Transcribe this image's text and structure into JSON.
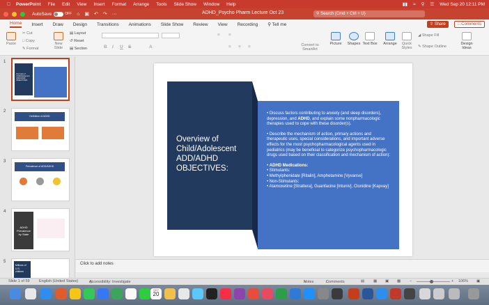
{
  "menubar": {
    "app": "PowerPoint",
    "items": [
      "File",
      "Edit",
      "View",
      "Insert",
      "Format",
      "Arrange",
      "Tools",
      "Slide Show",
      "Window",
      "Help"
    ],
    "datetime": "Wed Sep 20  12:11 PM"
  },
  "titlebar": {
    "autosave_label": "AutoSave",
    "autosave_state": "OFF",
    "doc_title": "ADHD_Psycho Pharm Lecture Oct 23",
    "search_placeholder": "Search (Cmd + Ctrl + U)"
  },
  "ribbon": {
    "tabs": [
      "Home",
      "Insert",
      "Draw",
      "Design",
      "Transitions",
      "Animations",
      "Slide Show",
      "Review",
      "View",
      "Recording",
      "Tell me"
    ],
    "share_label": "Share",
    "comments_label": "Comments",
    "buttons": {
      "paste": "Paste",
      "cut": "Cut",
      "copy": "Copy",
      "format": "Format",
      "new_slide": "New Slide",
      "layout": "Layout",
      "reset": "Reset",
      "section": "Section",
      "convert_smartart": "Convert to SmartArt",
      "picture": "Picture",
      "shapes": "Shapes",
      "text_box": "Text Box",
      "arrange": "Arrange",
      "quick_styles": "Quick Styles",
      "shape_fill": "Shape Fill",
      "shape_outline": "Shape Outline",
      "design_ideas": "Design Ideas"
    }
  },
  "thumbnails": [
    {
      "num": "1",
      "label": "Overview of Child/Adolescent ADD/ADHD OBJECTIVES:"
    },
    {
      "num": "2",
      "label": "Definition of ADHD"
    },
    {
      "num": "3",
      "label": "Prevalence of ADD/ADHD"
    },
    {
      "num": "4",
      "label": "ADHD Prevalence by State"
    },
    {
      "num": "5",
      "label": "Millions of U.S. children"
    }
  ],
  "slide": {
    "title": "Overview of Child/Adolescent ADD/ADHD OBJECTIVES:",
    "bullet1_pre": "Discuss factors contributing to anxiety (and sleep disorders), depression, and ",
    "bullet1_bold": "ADHD",
    "bullet1_post": ", and explain some nonpharmacologic therapies used to cope with these disorder(s).",
    "bullet2": "Describe the mechanism of action, primary actions and therapeutic uses, special considerations, and important adverse effects for the most psychopharmacological agents used in pediatrics (may be beneficial to categorize psychopharmacologic drugs used based on their classification and mechanism of action):",
    "meds_heading": "ADHD Medications:",
    "meds": [
      "Stimulants:",
      "Methylphenidate [Ritalin], Amphetamine [Vyvanse]",
      "Non-Stimulants:",
      "Atamoxetine [Strattera], Guanfacine [Intuniv], Clonidine [Kapvay]"
    ],
    "colors": {
      "title_panel": "#223a5e",
      "content_panel": "#4472c4"
    }
  },
  "notes_placeholder": "Click to add notes",
  "statusbar": {
    "slide_position": "Slide 1 of 59",
    "language": "English (United States)",
    "accessibility": "Accessibility: Investigate",
    "notes": "Notes",
    "comments": "Comments",
    "zoom": "106%"
  },
  "dock": {
    "calendar_day": "20",
    "calendar_month": "SEP"
  }
}
